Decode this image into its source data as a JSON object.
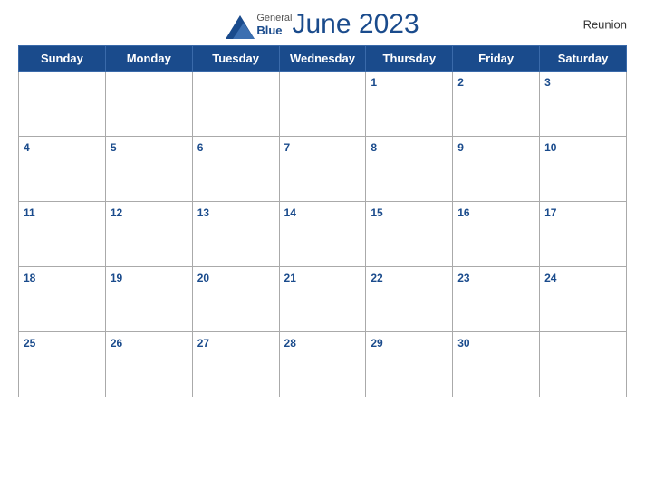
{
  "header": {
    "title": "June 2023",
    "region": "Reunion",
    "logo": {
      "general": "General",
      "blue": "Blue"
    }
  },
  "days_of_week": [
    "Sunday",
    "Monday",
    "Tuesday",
    "Wednesday",
    "Thursday",
    "Friday",
    "Saturday"
  ],
  "weeks": [
    [
      null,
      null,
      null,
      null,
      1,
      2,
      3
    ],
    [
      4,
      5,
      6,
      7,
      8,
      9,
      10
    ],
    [
      11,
      12,
      13,
      14,
      15,
      16,
      17
    ],
    [
      18,
      19,
      20,
      21,
      22,
      23,
      24
    ],
    [
      25,
      26,
      27,
      28,
      29,
      30,
      null
    ]
  ]
}
